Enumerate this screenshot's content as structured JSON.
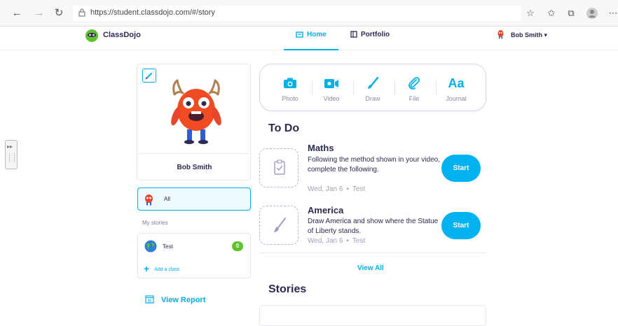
{
  "browser": {
    "url": "https://student.classdojo.com/#/story",
    "back_icon": "back-arrow-icon",
    "forward_icon": "forward-arrow-icon",
    "refresh_icon": "refresh-icon"
  },
  "app": {
    "brand": "ClassDojo",
    "accent_color": "#00aee8"
  },
  "nav": {
    "home": "Home",
    "portfolio": "Portfolio",
    "user": "Bob Smith"
  },
  "profile": {
    "name": "Bob Smith"
  },
  "sidebar": {
    "all_label": "All",
    "my_stories_label": "My stories",
    "class_name": "Test",
    "class_count": "0",
    "add_class": "Add a class",
    "view_report": "View Report",
    "report_icon_day": "31"
  },
  "post_options": [
    {
      "label": "Photo",
      "icon": "camera-icon"
    },
    {
      "label": "Video",
      "icon": "video-icon"
    },
    {
      "label": "Draw",
      "icon": "brush-icon"
    },
    {
      "label": "File",
      "icon": "paperclip-icon"
    },
    {
      "label": "Journal",
      "icon": "journal-icon"
    }
  ],
  "journal_icon_text": "Aa",
  "todo": {
    "title": "To Do",
    "items": [
      {
        "title": "Maths",
        "description": "Following the method shown in your video, complete the following.",
        "date": "Wed, Jan 6",
        "class": "Test",
        "button": "Start"
      },
      {
        "title": "America",
        "description": "Draw America and show where the Statue of Liberty stands.",
        "date": "Wed, Jan 6",
        "class": "Test",
        "button": "Start"
      }
    ],
    "view_all": "View All"
  },
  "stories": {
    "title": "Stories"
  }
}
